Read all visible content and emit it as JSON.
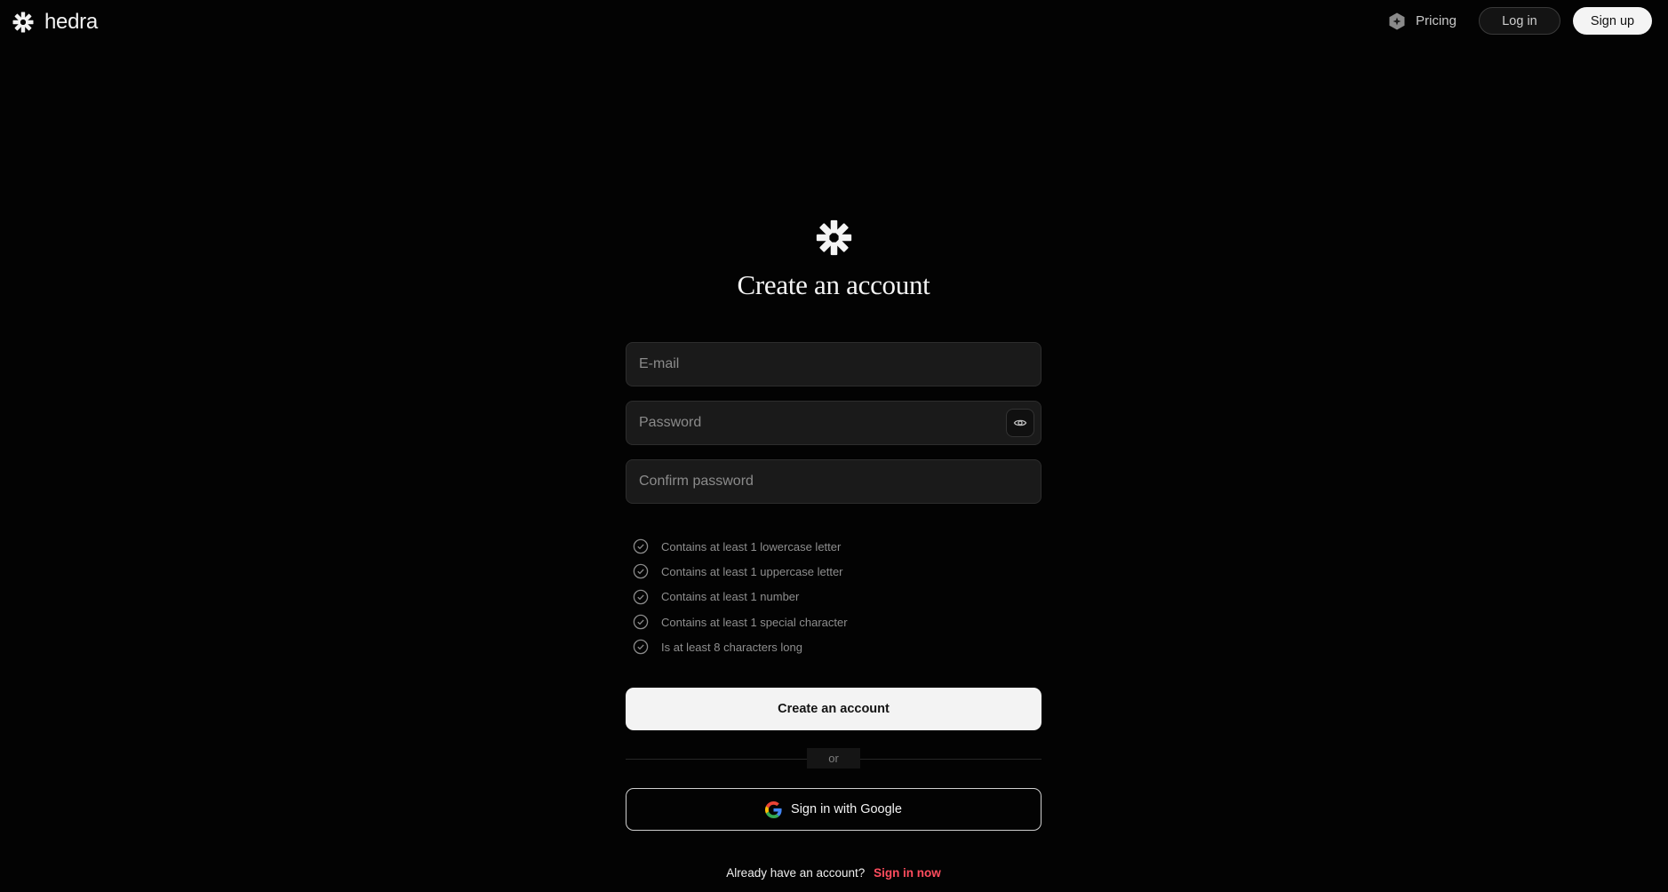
{
  "header": {
    "brand_name": "hedra",
    "nav": {
      "pricing_label": "Pricing",
      "login_label": "Log in",
      "signup_label": "Sign up"
    }
  },
  "form": {
    "title": "Create an account",
    "email": {
      "placeholder": "E-mail",
      "value": ""
    },
    "password": {
      "placeholder": "Password",
      "value": "",
      "toggle_icon": "eye-icon"
    },
    "confirm_password": {
      "placeholder": "Confirm password",
      "value": ""
    },
    "password_rules": [
      {
        "label": "Contains at least 1 lowercase letter",
        "icon": "check-circle-icon"
      },
      {
        "label": "Contains at least 1 uppercase letter",
        "icon": "check-circle-icon"
      },
      {
        "label": "Contains at least 1 number",
        "icon": "check-circle-icon"
      },
      {
        "label": "Contains at least 1 special character",
        "icon": "check-circle-icon"
      },
      {
        "label": "Is at least 8 characters long",
        "icon": "check-circle-icon"
      }
    ],
    "create_button_label": "Create an account",
    "divider_label": "or",
    "google_button_label": "Sign in with Google",
    "footer": {
      "prompt": "Already have an account?",
      "link_label": "Sign in now"
    }
  },
  "colors": {
    "background": "#030303",
    "link_accent": "#ff4d5e",
    "primary_button": "#f3f3f3"
  }
}
